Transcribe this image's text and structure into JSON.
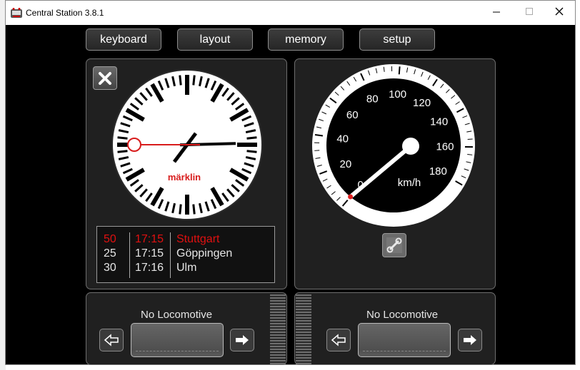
{
  "window": {
    "title": "Central Station 3.8.1"
  },
  "nav": {
    "keyboard": "keyboard",
    "layout": "layout",
    "memory": "memory",
    "setup": "setup"
  },
  "clock": {
    "brand": "märklin",
    "time_hours": 1,
    "time_minutes": 14,
    "time_seconds": 45
  },
  "timetable": [
    {
      "track": "50",
      "time": "17:15",
      "destination": "Stuttgart",
      "highlight": true
    },
    {
      "track": "25",
      "time": "17:15",
      "destination": "Göppingen",
      "highlight": false
    },
    {
      "track": "30",
      "time": "17:16",
      "destination": "Ulm",
      "highlight": false
    }
  ],
  "speedometer": {
    "unit": "km/h",
    "labels": [
      "0",
      "20",
      "40",
      "60",
      "80",
      "100",
      "120",
      "140",
      "160",
      "180"
    ],
    "speed": 0
  },
  "locos": {
    "left_label": "No Locomotive",
    "right_label": "No Locomotive"
  },
  "colors": {
    "highlight": "#e01010",
    "accent_red": "#d81c1c",
    "panel_bg": "#202020"
  }
}
